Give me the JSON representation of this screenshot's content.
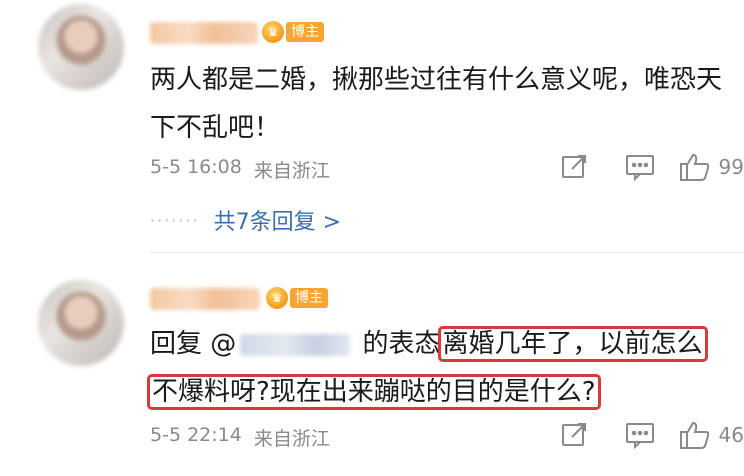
{
  "comments": [
    {
      "badge": "博主",
      "text_plain": "两人都是二婚，揪那些过往有什么意义呢，唯恐天下不乱吧！",
      "time": "5-5 16:08",
      "location": "来自浙江",
      "likes": "99",
      "replies_label": "共7条回复 >"
    },
    {
      "badge": "博主",
      "reply_prefix": "回复 @",
      "reply_mid": " 的表态",
      "highlight_1": "离婚几年了，以前怎么",
      "highlight_2": "不爆料呀?现在出来蹦哒的目的是什么?",
      "time": "5-5 22:14",
      "location": "来自浙江",
      "likes": "46"
    }
  ],
  "icons": {
    "crown": "crown-icon",
    "repost": "repost-icon",
    "comment": "comment-icon",
    "like": "thumbs-up-icon"
  },
  "colors": {
    "link": "#3b6fb0",
    "highlight_border": "#d83a3a",
    "badge": "#f7a531"
  }
}
